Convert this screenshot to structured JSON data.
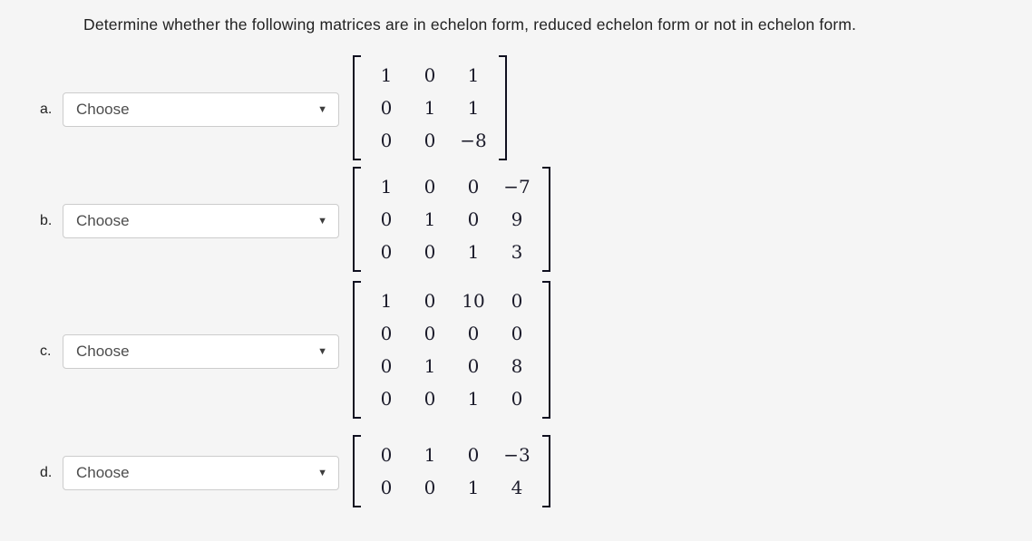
{
  "question": {
    "stem": "Determine whether the following matrices are in echelon form, reduced echelon form or not in echelon form."
  },
  "select": {
    "placeholder": "Choose",
    "caret_glyph": "▼",
    "options": [
      "Choose",
      "echelon form",
      "reduced echelon form",
      "not in echelon form"
    ]
  },
  "colors": {
    "page_background": "#f5f5f5",
    "select_background": "#ffffff",
    "select_border": "#cccccc",
    "text": "#222222",
    "matrix_text": "#1b1b2a"
  },
  "items": [
    {
      "label": "a.",
      "selected": "Choose",
      "matrix": {
        "rows": 3,
        "cols": 3,
        "values": [
          [
            "1",
            "0",
            "1"
          ],
          [
            "0",
            "1",
            "1"
          ],
          [
            "0",
            "0",
            "−8"
          ]
        ]
      }
    },
    {
      "label": "b.",
      "selected": "Choose",
      "matrix": {
        "rows": 3,
        "cols": 4,
        "values": [
          [
            "1",
            "0",
            "0",
            "−7"
          ],
          [
            "0",
            "1",
            "0",
            "9"
          ],
          [
            "0",
            "0",
            "1",
            "3"
          ]
        ]
      }
    },
    {
      "label": "c.",
      "selected": "Choose",
      "matrix": {
        "rows": 4,
        "cols": 4,
        "values": [
          [
            "1",
            "0",
            "10",
            "0"
          ],
          [
            "0",
            "0",
            "0",
            "0"
          ],
          [
            "0",
            "1",
            "0",
            "8"
          ],
          [
            "0",
            "0",
            "1",
            "0"
          ]
        ]
      }
    },
    {
      "label": "d.",
      "selected": "Choose",
      "matrix": {
        "rows": 2,
        "cols": 4,
        "values": [
          [
            "0",
            "1",
            "0",
            "−3"
          ],
          [
            "0",
            "0",
            "1",
            "4"
          ]
        ]
      }
    }
  ]
}
